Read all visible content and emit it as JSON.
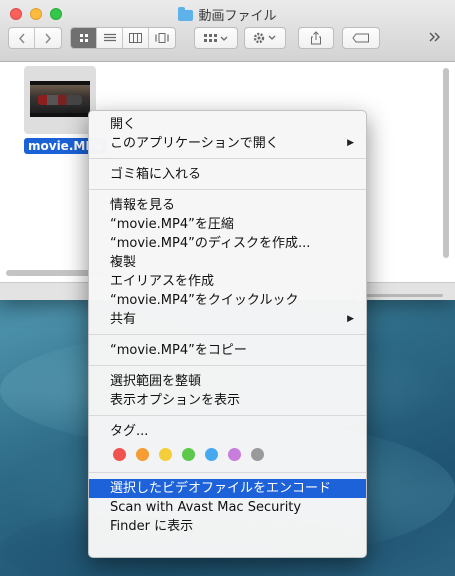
{
  "window": {
    "title": "動画ファイル",
    "file": {
      "name": "movie.MP4"
    }
  },
  "menu": {
    "groups": [
      [
        {
          "label": "開く",
          "submenu": false
        },
        {
          "label": "このアプリケーションで開く",
          "submenu": true
        }
      ],
      [
        {
          "label": "ゴミ箱に入れる",
          "submenu": false
        }
      ],
      [
        {
          "label": "情報を見る",
          "submenu": false
        },
        {
          "label": "“movie.MP4”を圧縮",
          "submenu": false
        },
        {
          "label": "“movie.MP4”のディスクを作成...",
          "submenu": false
        },
        {
          "label": "複製",
          "submenu": false
        },
        {
          "label": "エイリアスを作成",
          "submenu": false
        },
        {
          "label": "“movie.MP4”をクイックルック",
          "submenu": false
        },
        {
          "label": "共有",
          "submenu": true
        }
      ],
      [
        {
          "label": "“movie.MP4”をコピー",
          "submenu": false
        }
      ],
      [
        {
          "label": "選択範囲を整頓",
          "submenu": false
        },
        {
          "label": "表示オプションを表示",
          "submenu": false
        }
      ]
    ],
    "tags_label": "タグ...",
    "tag_colors": [
      "#f0524f",
      "#f59c34",
      "#f4ce3a",
      "#5cc84c",
      "#46a8ee",
      "#c77ddc",
      "#9a9a9a"
    ],
    "services": [
      {
        "label": "選択したビデオファイルをエンコード",
        "highlighted": true
      },
      {
        "label": "Scan with Avast Mac Security",
        "highlighted": false
      },
      {
        "label": "Finder に表示",
        "highlighted": false
      }
    ]
  }
}
